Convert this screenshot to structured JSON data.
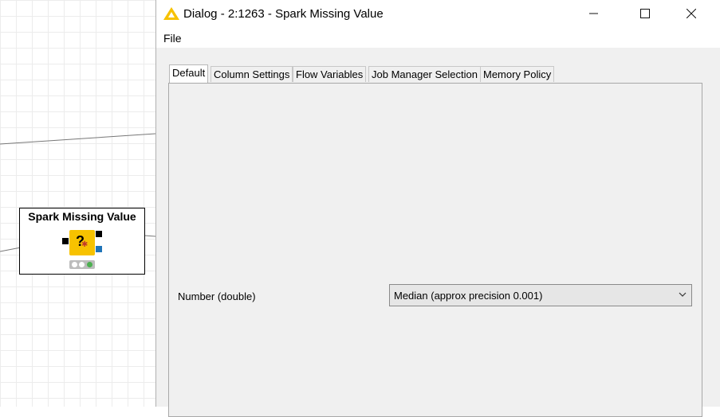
{
  "workflow": {
    "node": {
      "title": "Spark Missing Value",
      "icon": "question-mark-icon",
      "status": "green"
    }
  },
  "dialog": {
    "title": "Dialog - 2:1263 - Spark Missing Value",
    "menu": {
      "file": "File"
    },
    "tabs": [
      {
        "label": "Default",
        "active": true
      },
      {
        "label": "Column Settings"
      },
      {
        "label": "Flow Variables"
      },
      {
        "label": "Job Manager Selection"
      },
      {
        "label": "Memory Policy"
      }
    ],
    "setting": {
      "label": "Number (double)",
      "value": "Median (approx precision 0.001)"
    },
    "window_buttons": {
      "minimize": "–",
      "maximize": "☐",
      "close": "✕"
    }
  },
  "colors": {
    "accent": "#f7c200",
    "port_blue": "#1f74b8",
    "status_green": "#4caf50"
  }
}
